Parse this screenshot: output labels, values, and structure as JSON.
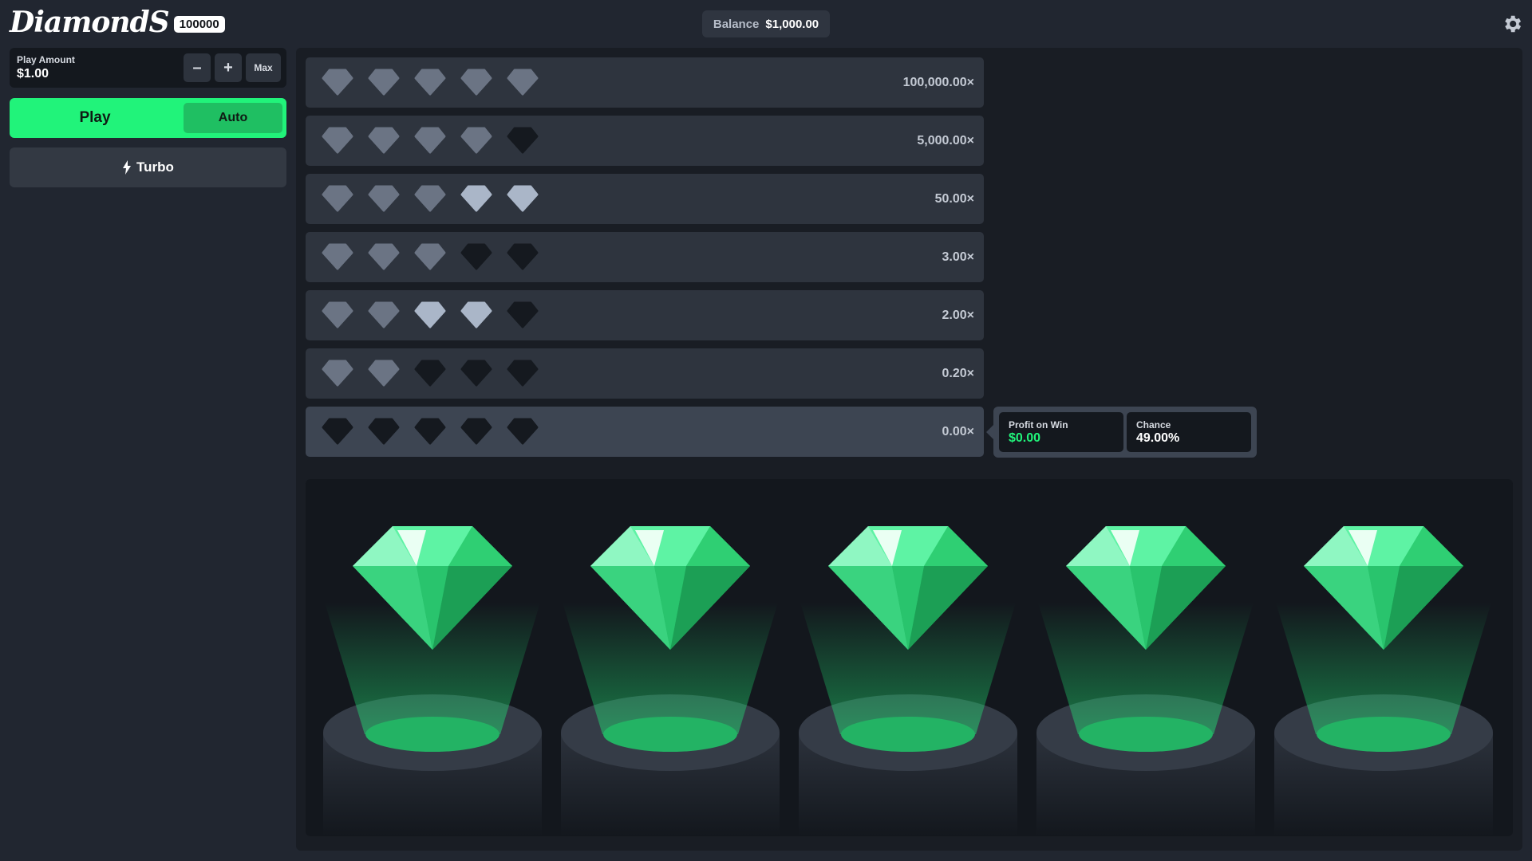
{
  "header": {
    "logo_text": "DiamondS",
    "logo_badge": "100000",
    "balance_label": "Balance",
    "balance_value": "$1,000.00",
    "settings_icon": "gear-icon"
  },
  "controls": {
    "play_amount_label": "Play Amount",
    "play_amount_value": "$1.00",
    "minus_label": "–",
    "plus_label": "+",
    "max_label": "Max",
    "play_label": "Play",
    "auto_label": "Auto",
    "turbo_label": "Turbo",
    "turbo_icon": "lightning-icon"
  },
  "paytable": [
    {
      "multiplier": "100,000.00×",
      "gems": [
        "m",
        "m",
        "m",
        "m",
        "m"
      ]
    },
    {
      "multiplier": "5,000.00×",
      "gems": [
        "m",
        "m",
        "m",
        "m",
        "d"
      ]
    },
    {
      "multiplier": "50.00×",
      "gems": [
        "m",
        "m",
        "m",
        "l",
        "l"
      ]
    },
    {
      "multiplier": "3.00×",
      "gems": [
        "m",
        "m",
        "m",
        "d",
        "d"
      ]
    },
    {
      "multiplier": "2.00×",
      "gems": [
        "m",
        "m",
        "l",
        "l",
        "d"
      ]
    },
    {
      "multiplier": "0.20×",
      "gems": [
        "m",
        "m",
        "d",
        "d",
        "d"
      ]
    },
    {
      "multiplier": "0.00×",
      "gems": [
        "d",
        "d",
        "d",
        "d",
        "d"
      ],
      "active": true
    }
  ],
  "gem_colors": {
    "m": "#6b7484",
    "l": "#aab6c8",
    "d": "#15191f"
  },
  "result": {
    "profit_label": "Profit on Win",
    "profit_value": "$0.00",
    "chance_label": "Chance",
    "chance_value": "49.00%"
  },
  "reels": [
    {
      "gem": "green-diamond"
    },
    {
      "gem": "green-diamond"
    },
    {
      "gem": "green-diamond"
    },
    {
      "gem": "green-diamond"
    },
    {
      "gem": "green-diamond"
    }
  ],
  "colors": {
    "accent_green": "#21f37a",
    "profit_green": "#21f37a"
  }
}
